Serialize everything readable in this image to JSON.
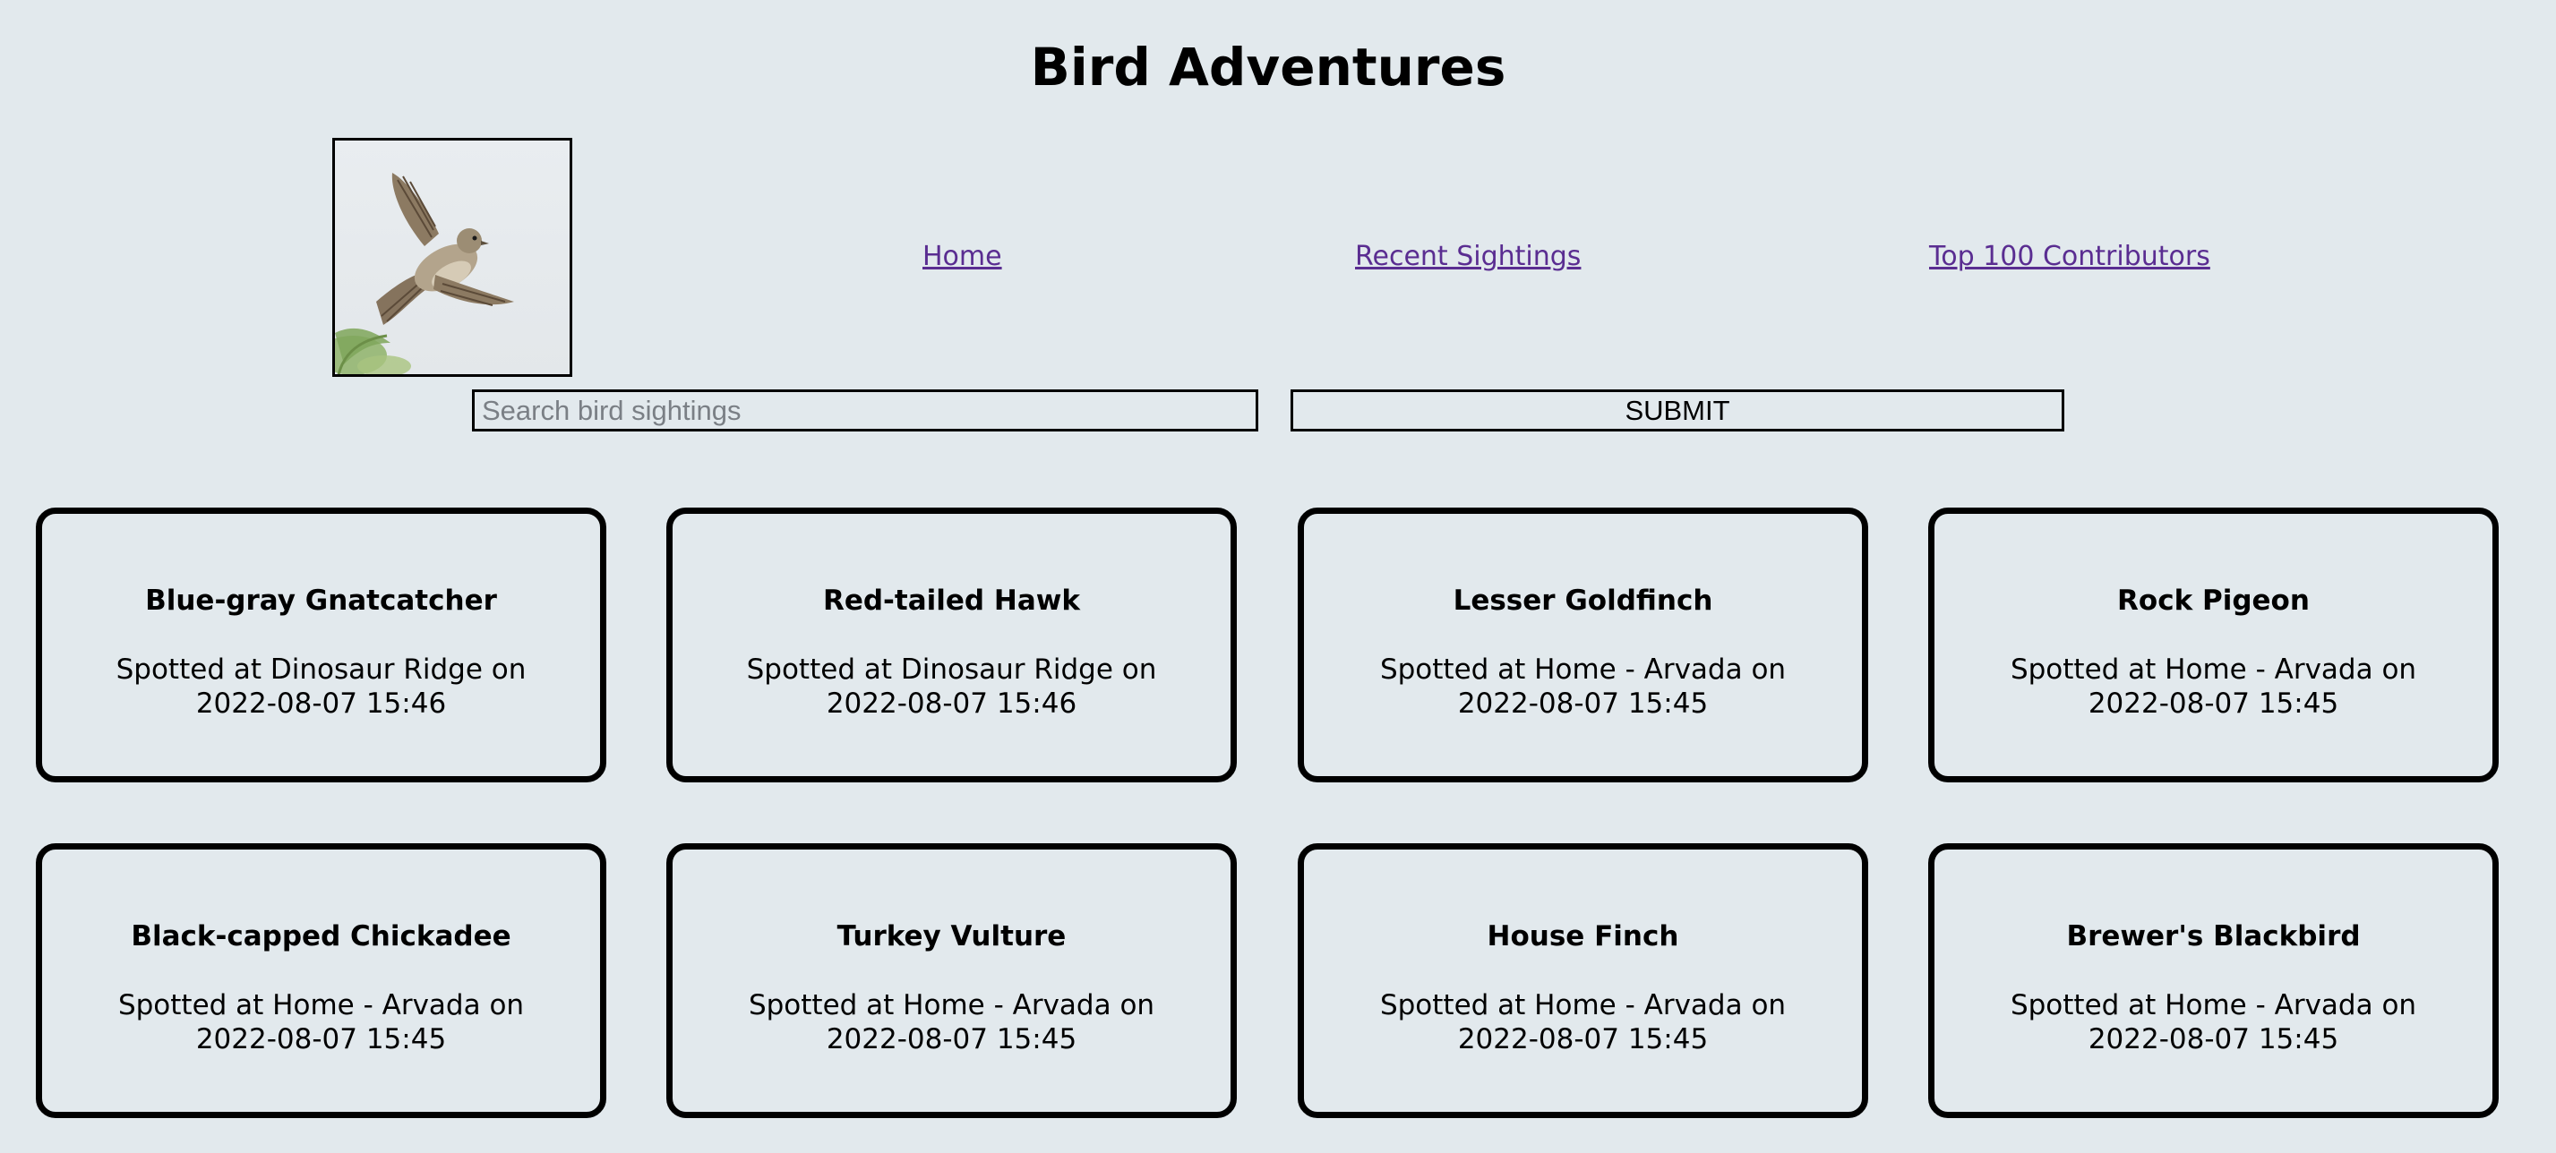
{
  "header": {
    "title": "Bird Adventures"
  },
  "logo": {
    "icon": "sparrow-in-flight-photo"
  },
  "nav": {
    "home": "Home",
    "recent": "Recent Sightings",
    "top": "Top 100 Contributors"
  },
  "search": {
    "placeholder": "Search bird sightings",
    "value": "",
    "submit_label": "SUBMIT"
  },
  "sightings": [
    {
      "name": "Blue-gray Gnatcatcher",
      "info": "Spotted at Dinosaur Ridge on 2022-08-07 15:46"
    },
    {
      "name": "Red-tailed Hawk",
      "info": "Spotted at Dinosaur Ridge on 2022-08-07 15:46"
    },
    {
      "name": "Lesser Goldfinch",
      "info": "Spotted at Home - Arvada on 2022-08-07 15:45"
    },
    {
      "name": "Rock Pigeon",
      "info": "Spotted at Home - Arvada on 2022-08-07 15:45"
    },
    {
      "name": "Black-capped Chickadee",
      "info": "Spotted at Home - Arvada on 2022-08-07 15:45"
    },
    {
      "name": "Turkey Vulture",
      "info": "Spotted at Home - Arvada on 2022-08-07 15:45"
    },
    {
      "name": "House Finch",
      "info": "Spotted at Home - Arvada on 2022-08-07 15:45"
    },
    {
      "name": "Brewer's Blackbird",
      "info": "Spotted at Home - Arvada on 2022-08-07 15:45"
    }
  ],
  "colors": {
    "background": "#e2e9ed",
    "link": "#5a2d91",
    "border": "#000000"
  }
}
